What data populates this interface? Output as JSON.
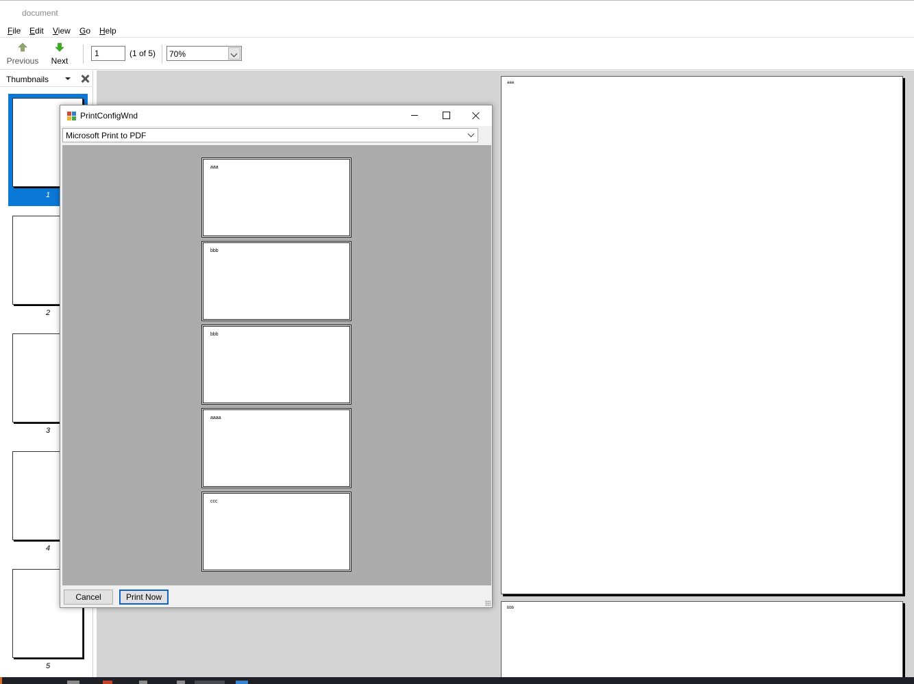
{
  "window": {
    "title": "document"
  },
  "menu": [
    {
      "accel": "F",
      "rest": "ile"
    },
    {
      "accel": "E",
      "rest": "dit"
    },
    {
      "accel": "V",
      "rest": "iew"
    },
    {
      "accel": "G",
      "rest": "o"
    },
    {
      "accel": "H",
      "rest": "elp"
    }
  ],
  "toolbar": {
    "previous_label": "Previous",
    "next_label": "Next",
    "page_value": "1",
    "page_of": "(1 of 5)",
    "zoom_value": "70%"
  },
  "thumbnails": {
    "header": "Thumbnails",
    "pages": [
      "1",
      "2",
      "3",
      "4",
      "5"
    ],
    "selected": "1"
  },
  "document": {
    "pages": [
      "aaa",
      "bbb"
    ]
  },
  "dialog": {
    "title": "PrintConfigWnd",
    "printer": "Microsoft Print to PDF",
    "preview_pages": [
      "aaa",
      "bbb",
      "bbb",
      "aaaa",
      "ccc"
    ],
    "cancel_label": "Cancel",
    "print_label": "Print Now"
  },
  "colors": {
    "selection": "#0a78d7",
    "preview_bg": "#ababab",
    "doc_bg": "#d4d4d4",
    "prev_arrow": "#8fa86a",
    "next_arrow": "#3cad1f"
  }
}
